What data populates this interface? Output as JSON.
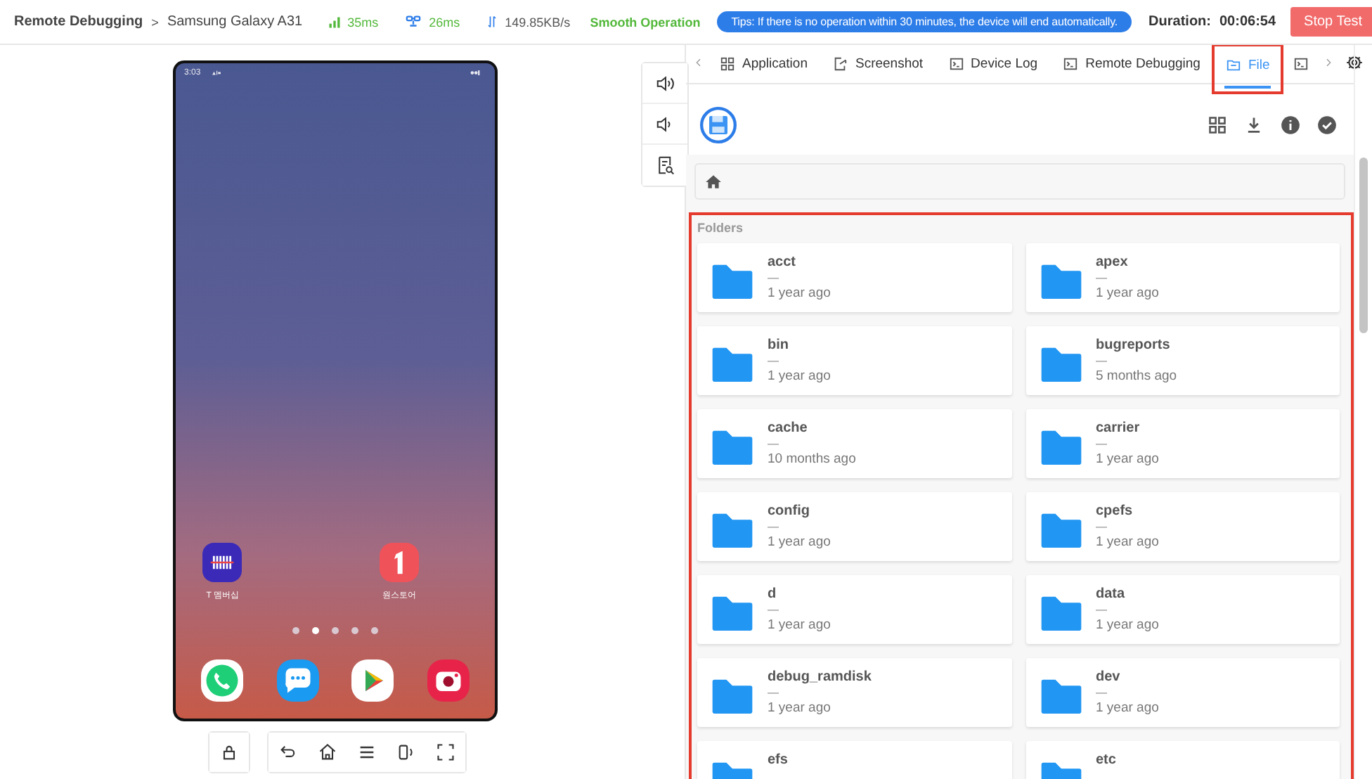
{
  "header": {
    "breadcrumb_root": "Remote Debugging",
    "separator": ">",
    "device": "Samsung Galaxy A31",
    "latency": "35ms",
    "ping": "26ms",
    "speed": "149.85KB/s",
    "status": "Smooth Operation",
    "tip": "Tips: If there is no operation within 30 minutes, the device will end automatically.",
    "duration_label": "Duration:",
    "duration": "00:06:54",
    "stop_button": "Stop Test"
  },
  "phone": {
    "time": "3:03",
    "apps": [
      {
        "label": "T 멤버십",
        "kind": "barcode"
      },
      {
        "label": "원스토어",
        "kind": "store"
      }
    ],
    "pages": [
      {
        "selected": false
      },
      {
        "selected": true
      },
      {
        "selected": false
      },
      {
        "selected": false
      },
      {
        "selected": false
      }
    ],
    "dock": [
      {
        "kind": "phone"
      },
      {
        "kind": "messages"
      },
      {
        "kind": "play"
      },
      {
        "kind": "camera"
      }
    ]
  },
  "tabs": [
    {
      "label": "Application",
      "kind": "grid",
      "selected": false,
      "highlighted": false
    },
    {
      "label": "Screenshot",
      "kind": "export",
      "selected": false,
      "highlighted": false
    },
    {
      "label": "Device Log",
      "kind": "terminal",
      "selected": false,
      "highlighted": false
    },
    {
      "label": "Remote Debugging",
      "kind": "terminal",
      "selected": false,
      "highlighted": false
    },
    {
      "label": "File",
      "kind": "folder",
      "selected": true,
      "highlighted": true
    },
    {
      "kind": "terminal",
      "selected": false,
      "highlighted": false
    }
  ],
  "folders": {
    "title": "Folders",
    "highlighted": true,
    "items": [
      {
        "name": "acct",
        "size": "—",
        "modified": "1 year ago"
      },
      {
        "name": "apex",
        "size": "—",
        "modified": "1 year ago"
      },
      {
        "name": "bin",
        "size": "—",
        "modified": "1 year ago"
      },
      {
        "name": "bugreports",
        "size": "—",
        "modified": "5 months ago"
      },
      {
        "name": "cache",
        "size": "—",
        "modified": "10 months ago"
      },
      {
        "name": "carrier",
        "size": "—",
        "modified": "1 year ago"
      },
      {
        "name": "config",
        "size": "—",
        "modified": "1 year ago"
      },
      {
        "name": "cpefs",
        "size": "—",
        "modified": "1 year ago"
      },
      {
        "name": "d",
        "size": "—",
        "modified": "1 year ago"
      },
      {
        "name": "data",
        "size": "—",
        "modified": "1 year ago"
      },
      {
        "name": "debug_ramdisk",
        "size": "—",
        "modified": "1 year ago"
      },
      {
        "name": "dev",
        "size": "—",
        "modified": "1 year ago"
      },
      {
        "name": "efs"
      },
      {
        "name": "etc"
      }
    ]
  }
}
